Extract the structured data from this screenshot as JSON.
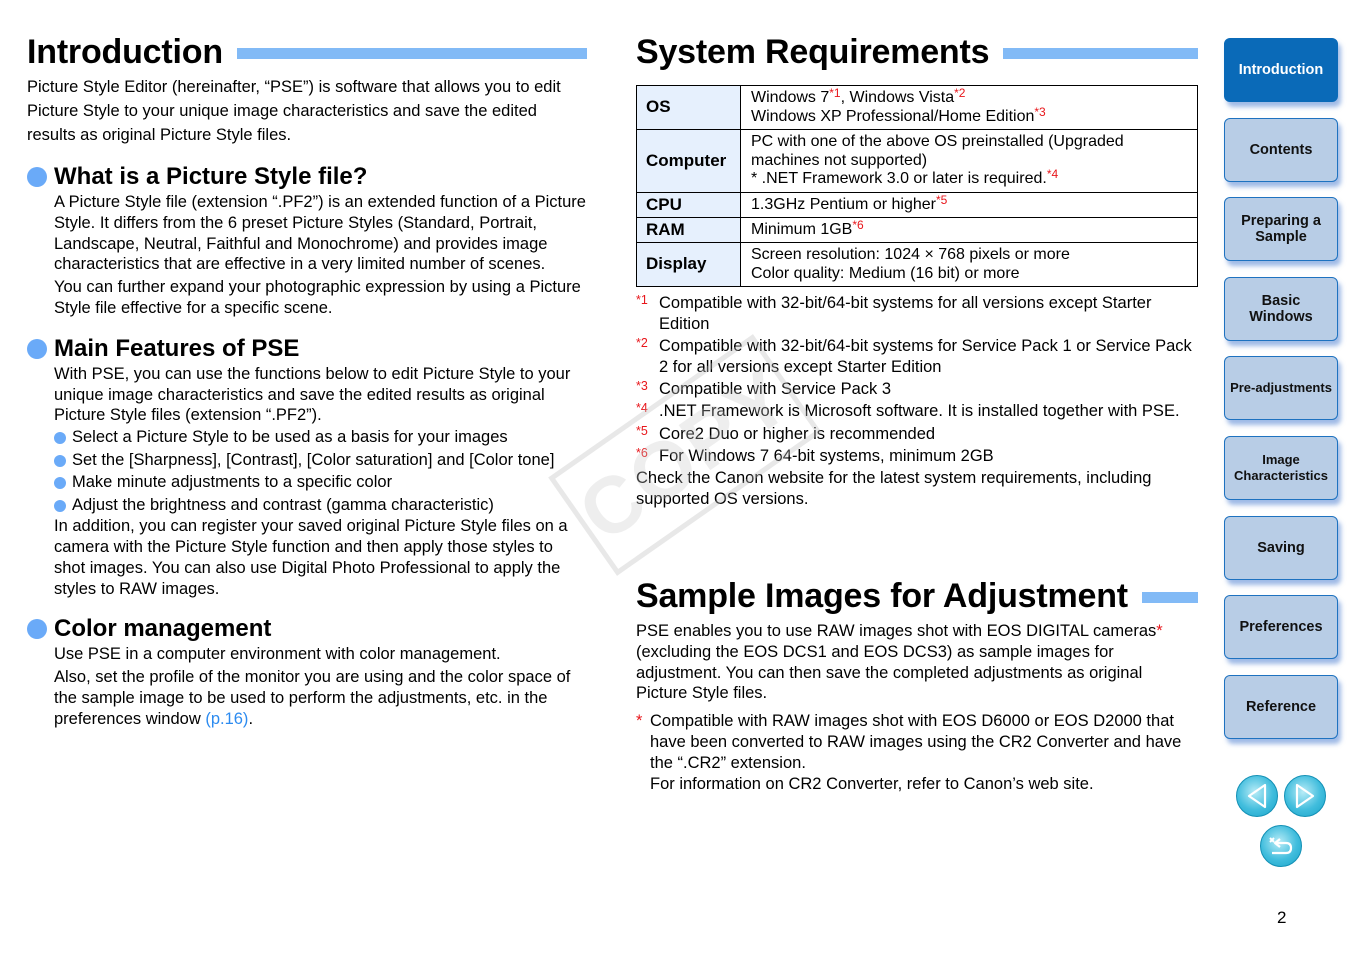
{
  "introduction": {
    "title": "Introduction",
    "intro": "Picture Style Editor (hereinafter, “PSE”) is software that allows you to edit Picture Style to your unique image characteristics and save the edited results as original Picture Style files.",
    "sections": [
      {
        "heading": "What is a Picture Style file?",
        "paragraphs": [
          "A Picture Style file (extension “.PF2”) is an extended function of a Picture Style. It differs from the 6 preset Picture Styles (Standard, Portrait, Landscape, Neutral, Faithful and Monochrome) and provides image characteristics that are effective in a very limited number of scenes.",
          "You can further expand your photographic expression by using a Picture Style file effective for a specific scene."
        ]
      },
      {
        "heading": "Main Features of PSE",
        "lead": "With PSE, you can use the functions below to edit Picture Style to your unique image characteristics and save the edited results as original Picture Style files (extension “.PF2”).",
        "bullets": [
          "Select a Picture Style to be used as a basis for your images",
          "Set the [Sharpness], [Contrast], [Color saturation] and [Color tone]",
          "Make minute adjustments to a specific color",
          "Adjust the brightness and contrast (gamma characteristic)"
        ],
        "tail": "In addition, you can register your saved original Picture Style files on a camera with the Picture Style function and then apply those styles to shot images. You can also use Digital Photo Professional to apply the styles to RAW images."
      },
      {
        "heading": "Color management",
        "line1": "Use PSE in a computer environment with color management.",
        "line2": "Also, set the profile of the monitor you are using and the color space of the sample image to be used to perform the adjustments, etc. in the preferences window ",
        "link": "(p.16)",
        "line2_end": "."
      }
    ]
  },
  "system_requirements": {
    "title": "System Requirements",
    "rows": [
      {
        "key": "OS",
        "lines": [
          {
            "text": "Windows 7",
            "mark": "*1",
            "text2": ", Windows Vista",
            "mark2": "*2"
          },
          {
            "text": "Windows XP Professional/Home Edition",
            "mark": "*3"
          }
        ]
      },
      {
        "key": "Computer",
        "lines": [
          {
            "text": "PC with one of the above OS preinstalled (Upgraded machines not supported)"
          },
          {
            "text": "* .NET Framework 3.0 or later is required.",
            "mark": "*4"
          }
        ]
      },
      {
        "key": "CPU",
        "lines": [
          {
            "text": "1.3GHz Pentium or higher",
            "mark": "*5"
          }
        ]
      },
      {
        "key": "RAM",
        "lines": [
          {
            "text": "Minimum 1GB",
            "mark": "*6"
          }
        ]
      },
      {
        "key": "Display",
        "lines": [
          {
            "text": "Screen resolution: 1024 × 768 pixels or more"
          },
          {
            "text": "Color quality: Medium (16 bit) or more"
          }
        ]
      }
    ],
    "notes": [
      {
        "mark": "*1",
        "text": "Compatible with 32-bit/64-bit systems for all versions except Starter Edition"
      },
      {
        "mark": "*2",
        "text": "Compatible with 32-bit/64-bit systems for Service Pack 1 or Service Pack 2 for all versions except Starter Edition"
      },
      {
        "mark": "*3",
        "text": "Compatible with Service Pack 3"
      },
      {
        "mark": "*4",
        "text": ".NET Framework is Microsoft software. It is installed together with PSE."
      },
      {
        "mark": "*5",
        "text": "Core2 Duo or higher is recommended"
      },
      {
        "mark": "*6",
        "text": "For Windows 7 64-bit systems, minimum 2GB"
      }
    ],
    "check_note": "Check the Canon website for the latest system requirements, including supported OS versions."
  },
  "sample_images": {
    "title": "Sample Images for Adjustment",
    "body_start": "PSE enables you to use RAW images shot with EOS DIGITAL cameras",
    "body_mark": "*",
    "body_end": " (excluding the EOS DCS1 and EOS DCS3) as sample images for adjustment. You can then save the completed adjustments as original Picture Style files.",
    "note_mark": "*",
    "note_lines": [
      "Compatible with RAW images shot with EOS D6000 or EOS D2000 that have been converted to RAW images using the CR2 Converter and have the “.CR2” extension.",
      "For information on CR2 Converter, refer to Canon’s web site."
    ]
  },
  "watermark": "COPY",
  "nav": {
    "items": [
      {
        "label": "Introduction",
        "active": true
      },
      {
        "label": "Contents"
      },
      {
        "label": "Preparing a Sample"
      },
      {
        "label": "Basic Windows"
      },
      {
        "label": "Pre-adjustments"
      },
      {
        "label": "Image Characteristics"
      },
      {
        "label": "Saving"
      },
      {
        "label": "Preferences"
      },
      {
        "label": "Reference"
      }
    ],
    "prev_icon": "triangle-left-icon",
    "next_icon": "triangle-right-icon",
    "back_icon": "return-arrow-icon"
  },
  "page_number": "2",
  "colors": {
    "accent_bar": "#82baf6",
    "bullet": "#6aaaf8",
    "note_red": "#e8161b",
    "link": "#2c8bf0",
    "nav_active": "#0a6ab8",
    "nav_inactive": "#b8cde6",
    "table_key_bg": "#e6f0fd"
  }
}
